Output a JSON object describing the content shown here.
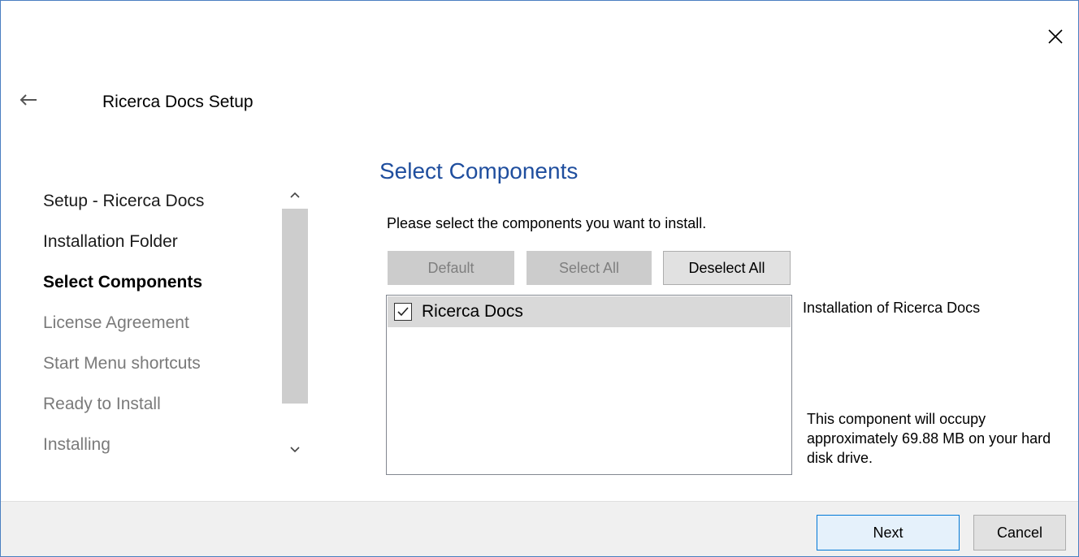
{
  "window": {
    "title": "Ricerca Docs Setup",
    "close_icon": "close-icon",
    "back_icon": "back-arrow-icon"
  },
  "sidebar": {
    "steps": [
      {
        "label": "Setup - Ricerca Docs",
        "state": "done"
      },
      {
        "label": "Installation Folder",
        "state": "done"
      },
      {
        "label": "Select Components",
        "state": "current"
      },
      {
        "label": "License Agreement",
        "state": "future"
      },
      {
        "label": "Start Menu shortcuts",
        "state": "future"
      },
      {
        "label": "Ready to Install",
        "state": "future"
      },
      {
        "label": "Installing",
        "state": "future"
      }
    ],
    "scroll_up_icon": "chevron-up-icon",
    "scroll_down_icon": "chevron-down-icon"
  },
  "main": {
    "heading": "Select Components",
    "instruction": "Please select the components you want to install.",
    "buttons": {
      "default": "Default",
      "select_all": "Select All",
      "deselect_all": "Deselect All"
    },
    "components": [
      {
        "label": "Ricerca Docs",
        "checked": true
      }
    ],
    "description": "Installation of Ricerca Docs",
    "size_text": "This component will occupy approximately 69.88 MB on your hard disk drive."
  },
  "footer": {
    "next": "Next",
    "cancel": "Cancel"
  },
  "colors": {
    "heading": "#1f4e9e",
    "window_border": "#4a7fc1",
    "next_border": "#0078d7",
    "footer_bg": "#f0f0f0",
    "selected_row": "#d9d9d9"
  }
}
